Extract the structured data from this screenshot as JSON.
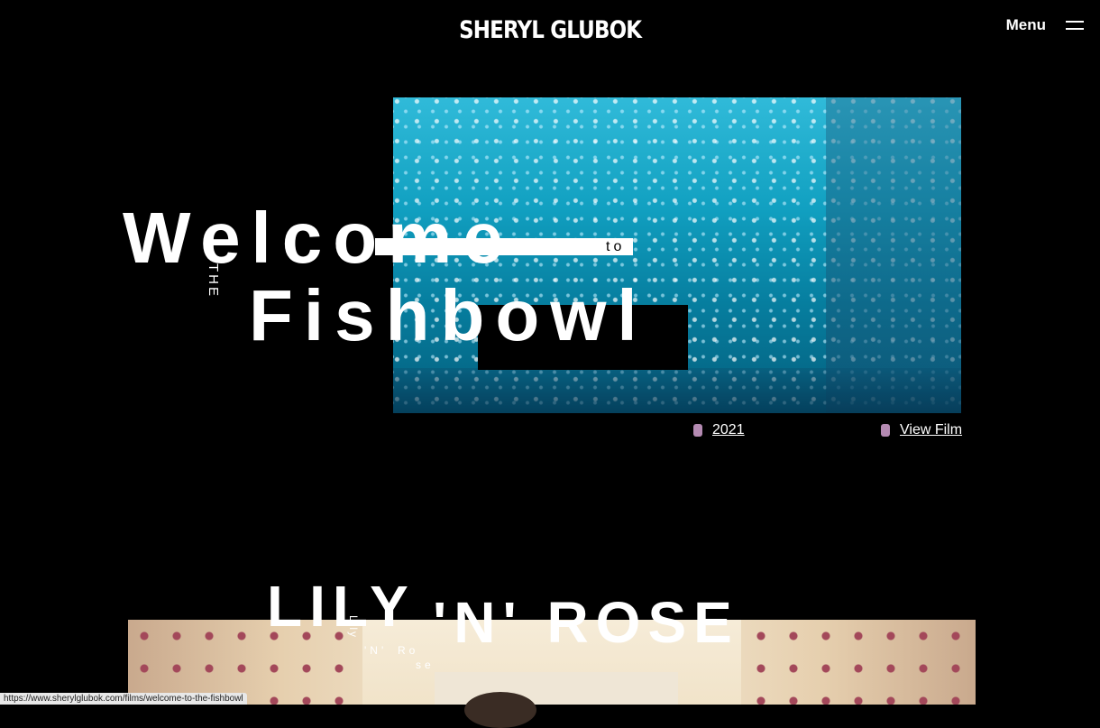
{
  "header": {
    "logo": "SHERYL GLUBOK",
    "menu_label": "Menu"
  },
  "film1": {
    "title_line1": "Welcome",
    "title_the": "THe",
    "title_to": "to",
    "title_line2": "Fishbowl",
    "year": "2021",
    "view_film": "View Film",
    "dot_color": "#b48ab2"
  },
  "film2": {
    "title_lily": "LILY",
    "title_nrose": "'N' ROSE",
    "small_lily": "Lily",
    "small_n": "'N'",
    "small_ro": "Ro",
    "small_se": "se"
  },
  "status_bar": {
    "url": "https://www.sherylglubok.com/films/welcome-to-the-fishbowl"
  }
}
